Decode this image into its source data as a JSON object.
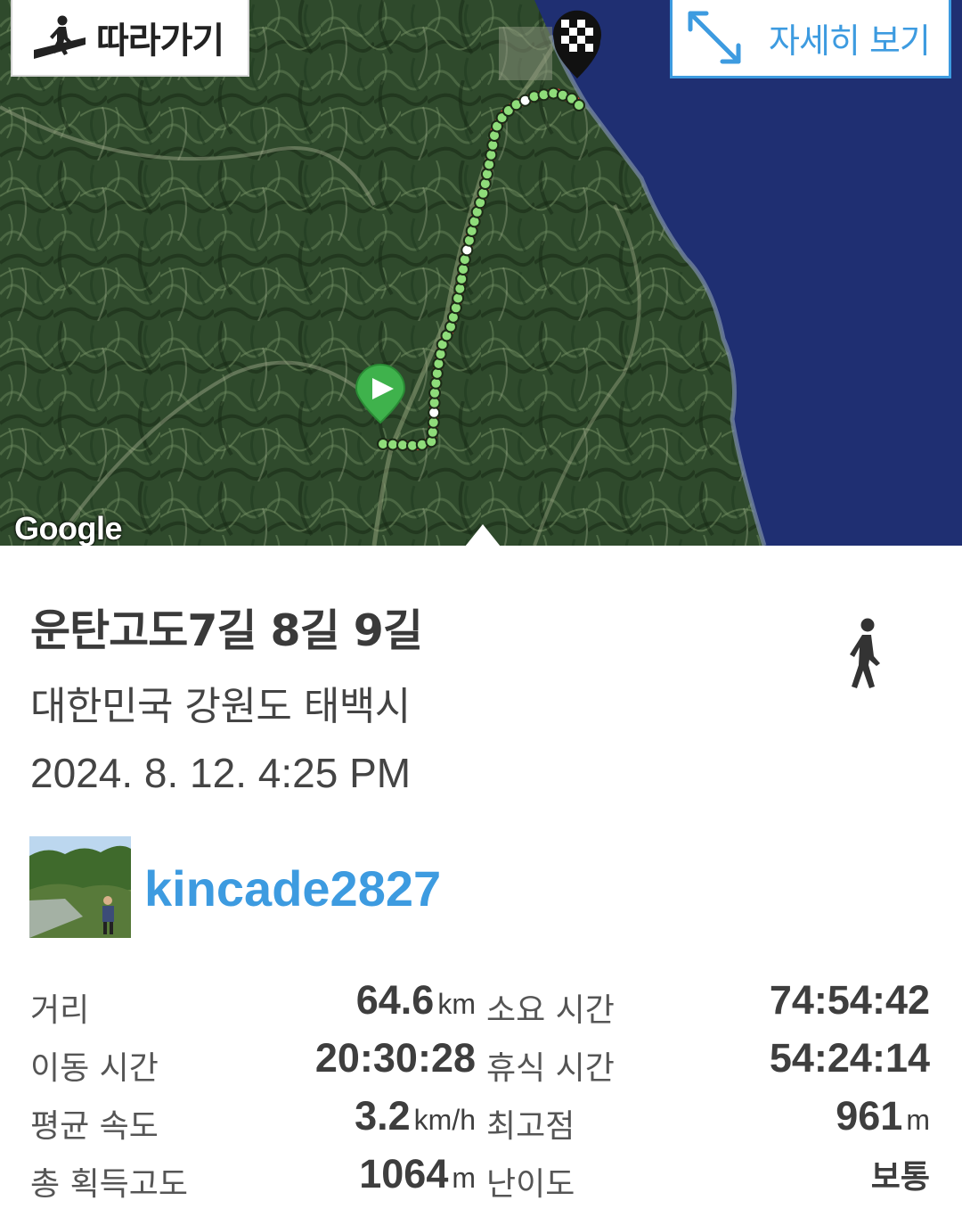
{
  "map": {
    "follow_label": "따라가기",
    "detail_label": "자세히 보기",
    "attribution": "Google",
    "route_color": "#e23030",
    "waypoint_color": "#8fdc7a",
    "sea_color": "#1f2f72"
  },
  "track": {
    "title": "운탄고도7길 8길 9길",
    "location": "대한민국 강원도 태백시",
    "datetime": "2024. 8. 12. 4:25 PM",
    "activity_icon": "walking-person-icon",
    "username": "kincade2827"
  },
  "stats": {
    "distance": {
      "label": "거리",
      "value": "64.6",
      "unit": "km"
    },
    "total_time": {
      "label": "소요 시간",
      "value": "74:54:42"
    },
    "moving_time": {
      "label": "이동 시간",
      "value": "20:30:28"
    },
    "rest_time": {
      "label": "휴식 시간",
      "value": "54:24:14"
    },
    "avg_speed": {
      "label": "평균 속도",
      "value": "3.2",
      "unit": "km/h"
    },
    "max_elevation": {
      "label": "최고점",
      "value": "961",
      "unit": "m"
    },
    "total_ascent": {
      "label": "총 획득고도",
      "value": "1064",
      "unit": "m"
    },
    "difficulty": {
      "label": "난이도",
      "value": "보통"
    }
  }
}
